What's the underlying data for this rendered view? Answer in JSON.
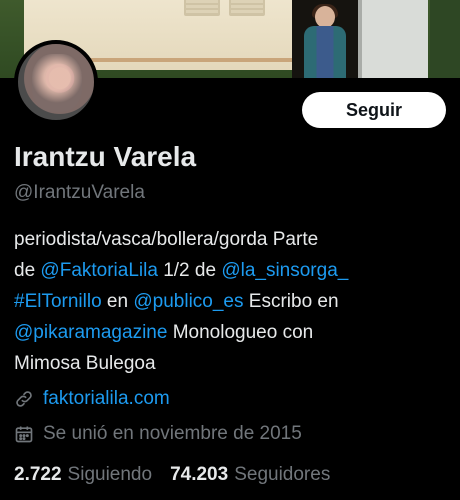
{
  "profile": {
    "display_name": "Irantzu Varela",
    "handle": "@IrantzuVarela",
    "follow_label": "Seguir",
    "bio": {
      "line1": "periodista/vasca/bollera/gorda Parte",
      "de": "de ",
      "mention1": "@FaktoriaLila",
      "half": " 1/2 de ",
      "mention2": "@la_sinsorga_",
      "hashtag": "#ElTornillo",
      "en": " en ",
      "mention3": "@publico_es",
      "escribo": " Escribo en",
      "mention4": "@pikaramagazine",
      "monologueo": " Monologueo con",
      "last_line": "Mimosa Bulegoa"
    },
    "website": "faktorialila.com",
    "joined": "Se unió en noviembre de 2015",
    "following_count": "2.722",
    "following_label": "Siguiendo",
    "followers_count": "74.203",
    "followers_label": "Seguidores"
  },
  "icons": {
    "website": "link-icon",
    "joined": "calendar-icon"
  },
  "colors": {
    "background": "#000000",
    "text": "#e7e9ea",
    "secondary": "#71767b",
    "link": "#1d9bf0",
    "button_bg": "#ffffff"
  }
}
